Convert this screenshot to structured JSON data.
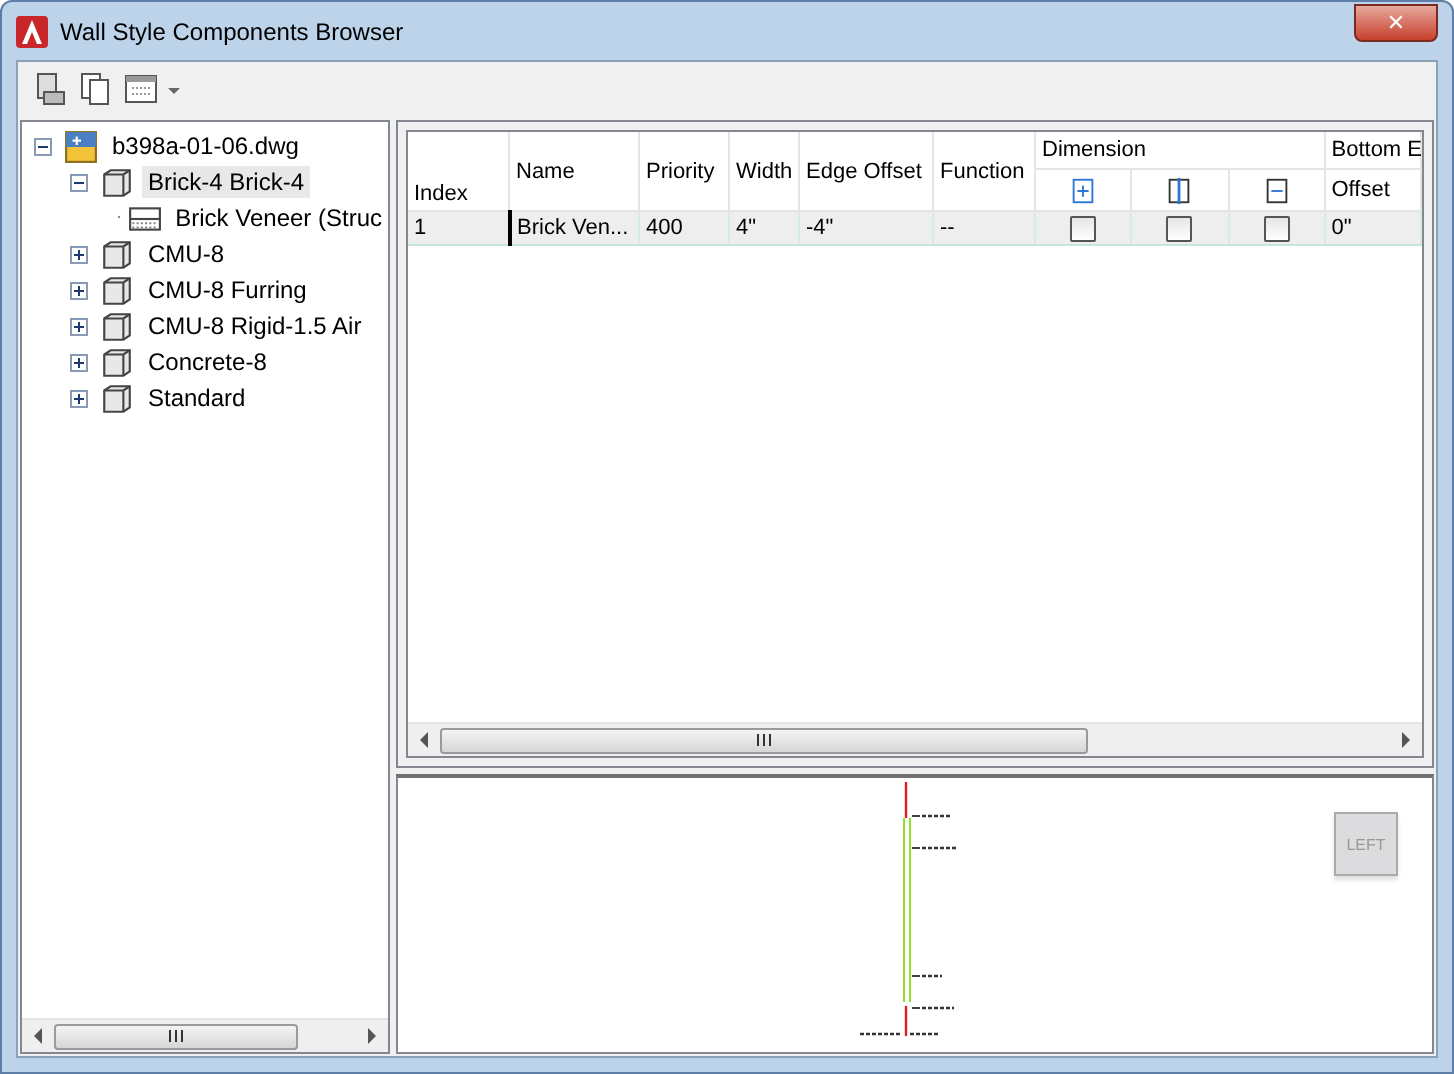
{
  "window": {
    "title": "Wall Style Components Browser",
    "close": "✕"
  },
  "tree": {
    "label": "b398a-01-06.dwg",
    "kind": "file",
    "expanded": true,
    "selected": false,
    "children": [
      {
        "label": "Brick-4 Brick-4",
        "kind": "style",
        "expanded": true,
        "selected": true,
        "children": [
          {
            "label": "Brick Veneer (Struc",
            "kind": "component",
            "selected": false
          }
        ]
      },
      {
        "label": "CMU-8",
        "kind": "style",
        "expanded": false,
        "selected": false
      },
      {
        "label": "CMU-8 Furring",
        "kind": "style",
        "expanded": false,
        "selected": false
      },
      {
        "label": "CMU-8 Rigid-1.5 Air",
        "kind": "style",
        "expanded": false,
        "selected": false
      },
      {
        "label": "Concrete-8",
        "kind": "style",
        "expanded": false,
        "selected": false
      },
      {
        "label": "Standard",
        "kind": "style",
        "expanded": false,
        "selected": false
      }
    ]
  },
  "grid": {
    "columns": [
      {
        "label": "Index",
        "kind": "text"
      },
      {
        "label": "Name",
        "kind": "text"
      },
      {
        "label": "Priority",
        "kind": "text"
      },
      {
        "label": "Width",
        "kind": "text"
      },
      {
        "label": "Edge Offset",
        "kind": "text"
      },
      {
        "label": "Function",
        "kind": "text"
      },
      {
        "label": "Dimension",
        "kind": "group",
        "children": [
          {
            "kind": "icon"
          },
          {
            "kind": "icon"
          },
          {
            "kind": "icon"
          }
        ]
      },
      {
        "label": "Bottom E",
        "kind": "group",
        "children": [
          {
            "kind": "text",
            "label": "Offset"
          }
        ]
      }
    ],
    "rows": [
      {
        "selected": true,
        "cells": [
          {
            "kind": "text",
            "value": "1"
          },
          {
            "kind": "text",
            "value": "Brick Ven..."
          },
          {
            "kind": "text",
            "value": "400"
          },
          {
            "kind": "text",
            "value": "4\""
          },
          {
            "kind": "text",
            "value": "-4\""
          },
          {
            "kind": "text",
            "value": "--"
          },
          {
            "kind": "check",
            "checked": false
          },
          {
            "kind": "check",
            "checked": false
          },
          {
            "kind": "check",
            "checked": false
          },
          {
            "kind": "text",
            "value": "0\""
          }
        ]
      }
    ]
  },
  "preview": {
    "view_button": {
      "label": "LEFT",
      "disabled": true
    }
  }
}
